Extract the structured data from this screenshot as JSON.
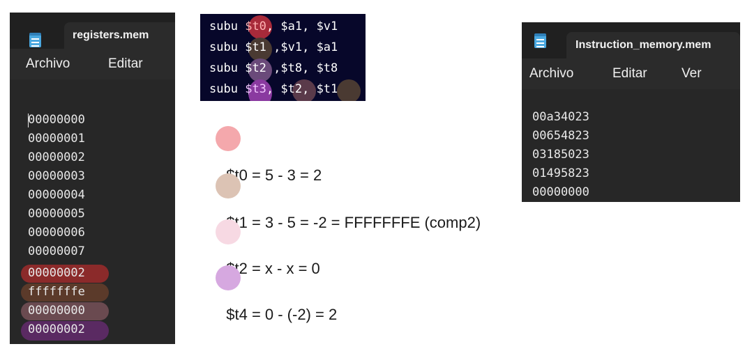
{
  "registers_window": {
    "tab_title": "registers.mem",
    "menu": [
      "Archivo",
      "Editar"
    ],
    "lines": [
      "00000000",
      "00000001",
      "00000002",
      "00000003",
      "00000004",
      "00000005",
      "00000006",
      "00000007",
      "00000002",
      "fffffffe",
      "00000000",
      "00000002"
    ],
    "highlight_colors": [
      "#8b2a2a",
      "#5b3a2a",
      "#6a4a50",
      "#5a2a62"
    ]
  },
  "code": {
    "lines": [
      {
        "op": "subu",
        "reg": "$t0",
        "rest": ", $a1, $v1"
      },
      {
        "op": "subu",
        "reg": "$t1",
        "rest": " ,$v1, $a1"
      },
      {
        "op": "subu",
        "reg": "$t2",
        "rest": " ,$t8, $t8"
      },
      {
        "op": "subu",
        "reg": "$t3",
        "rest": ", $t2, $t1"
      }
    ],
    "reg_circle_colors": [
      "#a82a3a",
      "#4a3a32",
      "#6a4a7a",
      "#8a3aa0"
    ],
    "extra_circle_colors": [
      "#5a3a4a",
      "#4a3a32"
    ]
  },
  "equations": [
    {
      "reg": "$t0",
      "rest": " = 5 - 3 = 2",
      "color": "#f4a8ac"
    },
    {
      "reg": "$t1",
      "rest": " = 3 - 5 = -2 = FFFFFFFE (comp2)",
      "color": "#dcc3b4"
    },
    {
      "reg": "$t2",
      "rest": " = x - x = 0",
      "color": "#f7d9e3"
    },
    {
      "reg": "$t4",
      "rest": " = 0 - (-2) = 2",
      "color": "#d6a8e0"
    }
  ],
  "instruction_window": {
    "tab_title": "Instruction_memory.mem",
    "menu": [
      "Archivo",
      "Editar",
      "Ver"
    ],
    "lines": [
      "00a34023",
      "00654823",
      "03185023",
      "01495823",
      "00000000"
    ]
  }
}
